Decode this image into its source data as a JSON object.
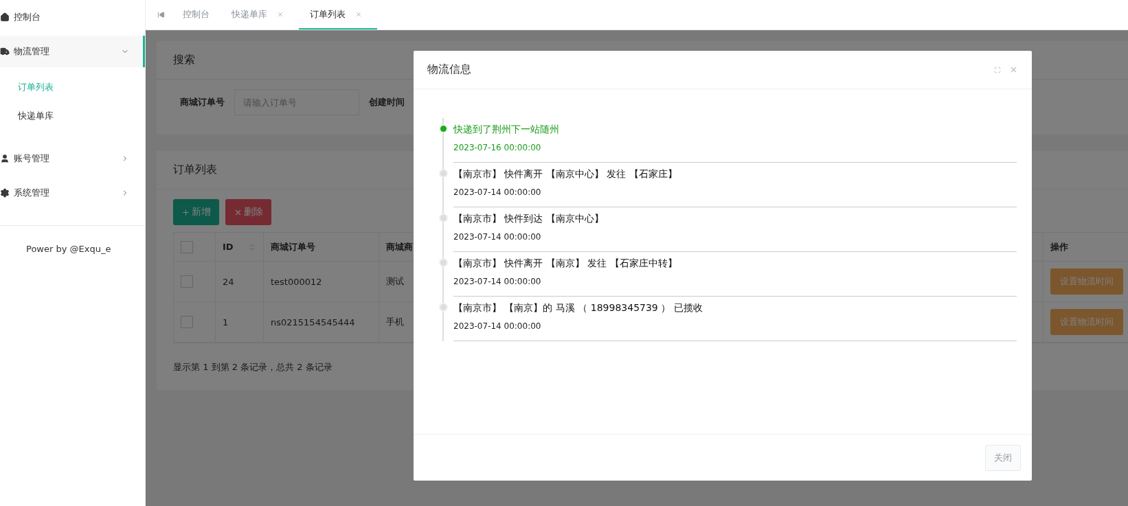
{
  "sidebar": {
    "items": [
      {
        "label": "控制台",
        "kind": "link",
        "expanded": false
      },
      {
        "label": "物流管理",
        "kind": "group",
        "expanded": true,
        "children": [
          {
            "label": "订单列表",
            "selected": true
          },
          {
            "label": "快递单库",
            "selected": false
          }
        ]
      },
      {
        "label": "账号管理",
        "kind": "group",
        "expanded": false
      },
      {
        "label": "系统管理",
        "kind": "group",
        "expanded": false
      }
    ],
    "footer": "Power by @Exqu_e"
  },
  "tabs": [
    {
      "label": "控制台",
      "closable": false,
      "selected": false
    },
    {
      "label": "快递单库",
      "closable": true,
      "selected": false
    },
    {
      "label": "订单列表",
      "closable": true,
      "selected": true
    }
  ],
  "search": {
    "title": "搜索",
    "fields": [
      {
        "label": "商城订单号",
        "placeholder": "请输入订单号"
      },
      {
        "label": "创建时间"
      }
    ]
  },
  "orders": {
    "title": "订单列表",
    "buttons": [
      {
        "label": "新增",
        "kind": "add"
      },
      {
        "label": "删除",
        "kind": "delete"
      }
    ],
    "table": {
      "all_checked": false,
      "columns": [
        "ID",
        "商城订单号",
        "商城商",
        "操作"
      ],
      "rows": [
        {
          "checked": false,
          "cells": [
            "24",
            "test000012",
            "测试"
          ],
          "action": "设置物流时间"
        },
        {
          "checked": false,
          "cells": [
            "1",
            "ns0215154545444",
            "手机"
          ],
          "action": "设置物流时间"
        }
      ]
    },
    "summary": "显示第 1 到第 2 条记录，总共 2 条记录"
  },
  "dialog": {
    "title": "物流信息",
    "events": [
      {
        "text": "快递到了荆州下一站随州",
        "time": "2023-07-16 00:00:00",
        "current": true
      },
      {
        "text": "【南京市】 快件离开 【南京中心】 发往 【石家庄】",
        "time": "2023-07-14 00:00:00",
        "current": false
      },
      {
        "text": "【南京市】 快件到达 【南京中心】",
        "time": "2023-07-14 00:00:00",
        "current": false
      },
      {
        "text": "【南京市】 快件离开 【南京】 发往 【石家庄中转】",
        "time": "2023-07-14 00:00:00",
        "current": false
      },
      {
        "text": "【南京市】 【南京】的 马溪 （ 18998345739 ） 已揽收",
        "time": "2023-07-14 00:00:00",
        "current": false
      }
    ],
    "close_button": "关闭"
  }
}
